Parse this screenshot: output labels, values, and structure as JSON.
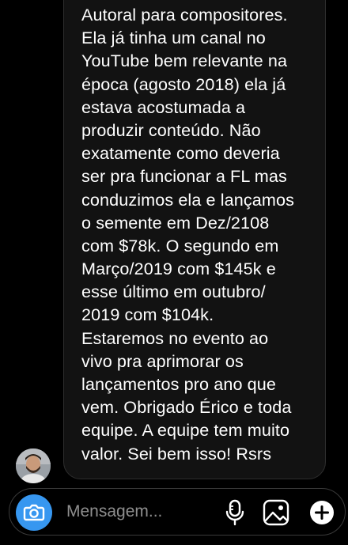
{
  "thread": {
    "message_lines": [
      "Autoral para compositores.",
      "Ela já tinha um canal no",
      "YouTube bem relevante na",
      "época (agosto 2018) ela já",
      "estava acostumada a",
      "produzir conteúdo. Não",
      "exatamente como deveria",
      "ser pra funcionar a FL mas",
      "conduzimos ela e lançamos",
      "o semente em Dez/2108",
      "com $78k. O segundo em",
      "Março/2019 com $145k e",
      "esse último em outubro/",
      "2019 com $104k.",
      "Estaremos no evento ao",
      "vivo pra aprimorar os",
      "lançamentos pro ano que",
      "vem. Obrigado Érico e toda",
      "equipe. A equipe tem muito",
      "valor. Sei bem isso! Rsrs"
    ]
  },
  "composer": {
    "placeholder": "Mensagem...",
    "value": "",
    "camera_icon": "camera-icon",
    "mic_icon": "microphone-icon",
    "gallery_icon": "gallery-icon",
    "plus_icon": "plus-icon"
  },
  "colors": {
    "background": "#000000",
    "bubble": "#121212",
    "bubble_border": "#2e2e2e",
    "accent": "#3797f0",
    "placeholder": "#8e8e8e"
  }
}
